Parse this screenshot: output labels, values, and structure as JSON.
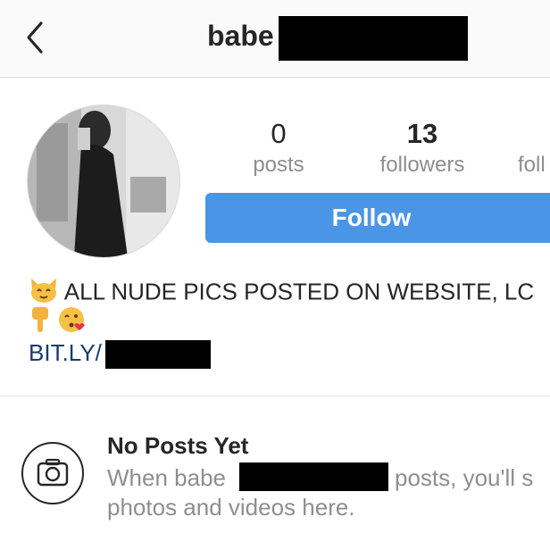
{
  "header": {
    "back_icon": "chevron-left-icon",
    "username_visible": "babe"
  },
  "profile": {
    "avatar": "profile-photo",
    "stats": {
      "posts": {
        "value": "0",
        "label": "posts"
      },
      "followers": {
        "value": "13",
        "label": "followers"
      },
      "following": {
        "label_partial": "foll"
      }
    },
    "follow_label": "Follow",
    "bio_line1": "ALL NUDE PICS POSTED ON WEBSITE, LC",
    "bio_emoji_line1": "cat-emoji",
    "bio_emoji_line2": [
      "pointing-down-emoji",
      "kiss-face-emoji"
    ],
    "link_visible": "BIT.LY/"
  },
  "empty_state": {
    "icon": "camera-icon",
    "title": "No Posts Yet",
    "line1_before": "When babe",
    "line1_after": "posts, you'll s",
    "line2": "photos and videos here."
  },
  "colors": {
    "follow_button": "#4a95e6",
    "link": "#1a3a6e",
    "muted": "#8e8e8e"
  }
}
